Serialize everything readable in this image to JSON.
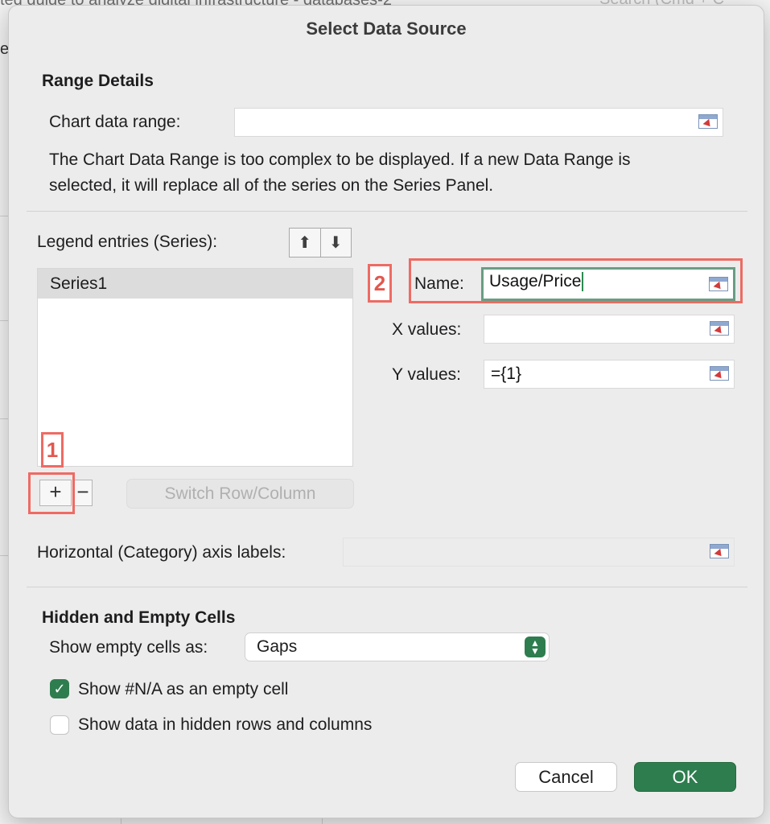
{
  "background": {
    "window_title_fragment": "ted guide to analyze digital infrastructure - databases-2",
    "search_placeholder": "Search (Cmd + C",
    "left_fragment": "ev"
  },
  "dialog": {
    "title": "Select Data Source",
    "range_details": {
      "heading": "Range Details",
      "chart_data_range_label": "Chart data range:",
      "chart_data_range_value": "",
      "message": "The Chart Data Range is too complex to be displayed. If a new Data Range is selected, it will replace all of the series on the Series Panel."
    },
    "series": {
      "legend_label": "Legend entries (Series):",
      "move_up_icon": "arrow-up",
      "move_down_icon": "arrow-down",
      "items": [
        "Series1"
      ],
      "add_symbol": "+",
      "remove_symbol": "−",
      "switch_label": "Switch Row/Column",
      "name_label": "Name:",
      "name_value": "Usage/Price",
      "x_label": "X values:",
      "x_value": "",
      "y_label": "Y values:",
      "y_value": "={1}"
    },
    "axis": {
      "label": "Horizontal (Category) axis labels:",
      "value": ""
    },
    "hidden_empty": {
      "heading": "Hidden and Empty Cells",
      "show_empty_label": "Show empty cells as:",
      "show_empty_value": "Gaps",
      "na_label": "Show #N/A as an empty cell",
      "na_checked": true,
      "hidden_label": "Show data in hidden rows and columns",
      "hidden_checked": false
    },
    "buttons": {
      "cancel": "Cancel",
      "ok": "OK"
    },
    "annotations": {
      "one": "1",
      "two": "2"
    }
  },
  "colors": {
    "accent": "#2e7d4f",
    "annotation": "#ee6b63",
    "focus_ring": "#6a9d84"
  }
}
